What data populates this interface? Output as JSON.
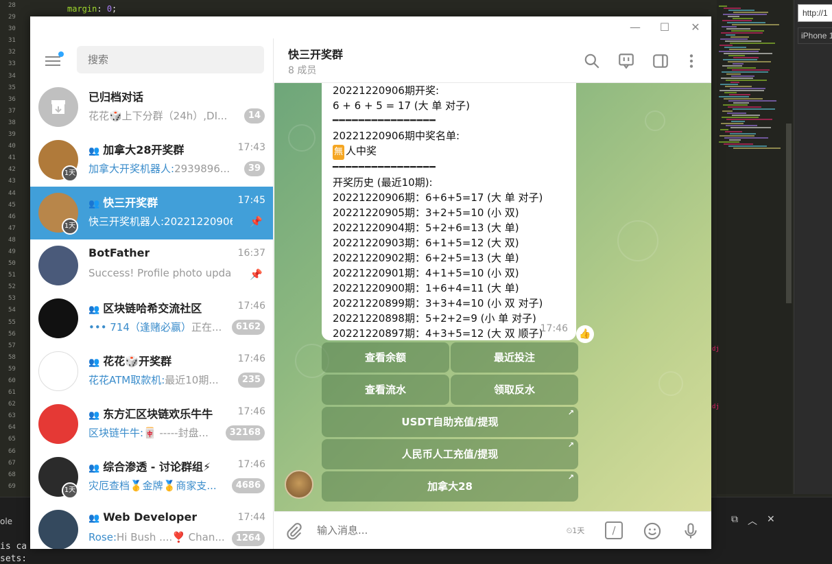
{
  "editor": {
    "line_numbers": [
      "28",
      "29",
      "30",
      "31",
      "32",
      "33",
      "34",
      "35",
      "36",
      "37",
      "38",
      "39",
      "40",
      "41",
      "42",
      "43",
      "44",
      "45",
      "46",
      "47",
      "48",
      "49",
      "50",
      "51",
      "52",
      "53",
      "54",
      "55",
      "56",
      "57",
      "58",
      "59",
      "60",
      "61",
      "62",
      "63",
      "64",
      "65",
      "66",
      "67",
      "68",
      "69"
    ],
    "code_top_prop": "margin",
    "code_top_val": "0",
    "url_text": "http://1",
    "device_text": "iPhone 1",
    "panel_tab": "ole",
    "panel_line1": "is ca",
    "panel_line2": "sets:",
    "red_marks": [
      "dj",
      "dj"
    ]
  },
  "window": {
    "minimize": "—",
    "maximize": "☐",
    "close": "✕"
  },
  "sidebar": {
    "search_placeholder": "搜索",
    "chats": [
      {
        "title": "已归档对话",
        "time": "",
        "preview_who": "",
        "preview": "花花🎲上下分群（24h）,DI...",
        "count": "14",
        "pinned": false,
        "group": false,
        "day": false,
        "active": false
      },
      {
        "title": "加拿大28开奖群",
        "time": "17:43",
        "preview_who": "加拿大开奖机器人:",
        "preview": "2939896...",
        "count": "39",
        "pinned": false,
        "group": true,
        "day": true,
        "active": false
      },
      {
        "title": "快三开奖群",
        "time": "17:45",
        "preview_who": "",
        "preview": "快三开奖机器人:20221220906...",
        "count": "",
        "pinned": true,
        "group": true,
        "day": true,
        "active": true
      },
      {
        "title": "BotFather",
        "time": "16:37",
        "preview_who": "",
        "preview": "Success! Profile photo upda...",
        "count": "",
        "pinned": true,
        "group": false,
        "day": false,
        "active": false
      },
      {
        "title": "区块链哈希交流社区",
        "time": "17:46",
        "preview_who": "••• 714（逢赌必赢）",
        "preview": "正在...",
        "count": "6162",
        "pinned": false,
        "group": true,
        "day": false,
        "active": false
      },
      {
        "title": "花花🎲开奖群",
        "time": "17:46",
        "preview_who": "花花ATM取款机:",
        "preview": "最近10期...",
        "count": "235",
        "pinned": false,
        "group": true,
        "day": false,
        "active": false
      },
      {
        "title": "东方汇区块链欢乐牛牛",
        "time": "17:46",
        "preview_who": "区块链牛牛:",
        "preview": "🀄 -----封盘...",
        "count": "32168",
        "pinned": false,
        "group": true,
        "day": false,
        "active": false
      },
      {
        "title": "综合渗透 - 讨论群组⚡",
        "time": "17:46",
        "preview_who": "灾厄查档🥇金牌🥇商家支...",
        "preview": "",
        "count": "4686",
        "pinned": false,
        "group": true,
        "day": true,
        "active": false
      },
      {
        "title": "Web Developer",
        "time": "17:44",
        "preview_who": "Rose:",
        "preview": "Hi Bush ....❣️  Chan...",
        "count": "1264",
        "pinned": false,
        "group": true,
        "day": false,
        "active": false
      }
    ]
  },
  "header": {
    "title": "快三开奖群",
    "subtitle": "8 成员"
  },
  "message": {
    "lines": [
      "20221220906期开奖:",
      "6 + 6 + 5 = 17 (大 单 对子)",
      "━━━━━━━━━━━━━━━━",
      "20221220906期中奖名单:",
      "人中奖",
      "━━━━━━━━━━━━━━━━",
      "开奖历史 (最近10期):",
      "20221220906期：6+6+5=17 (大 单 对子)",
      "20221220905期：3+2+5=10 (小 双)",
      "20221220904期：5+2+6=13 (大 单)",
      "20221220903期：6+1+5=12 (大 双)",
      "20221220902期：6+2+5=13 (大 单)",
      "20221220901期：4+1+5=10 (小 双)",
      "20221220900期：1+6+4=11 (大 单)",
      "20221220899期：3+3+4=10 (小 双 对子)",
      "20221220898期：5+2+2=9 (小 单 对子)",
      "20221220897期：4+3+5=12 (大 双 顺子)"
    ],
    "wu_badge": "無",
    "time": "17:46",
    "reaction": "👍"
  },
  "keyboard": {
    "balance": "查看余额",
    "recent_bets": "最近投注",
    "flow": "查看流水",
    "rebate": "领取反水",
    "usdt": "USDT自助充值/提现",
    "rmb": "人民币人工充值/提现",
    "canada": "加拿大28"
  },
  "composer": {
    "placeholder": "输入消息...",
    "timer_label": "1天",
    "command_label": "/"
  }
}
